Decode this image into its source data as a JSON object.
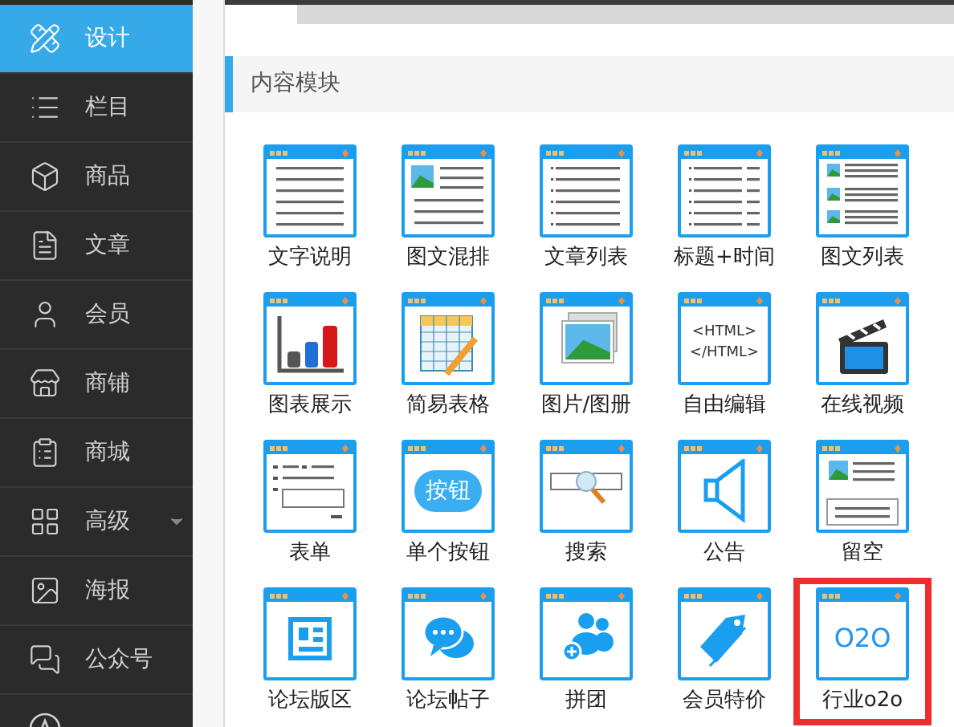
{
  "sidebar": {
    "items": [
      {
        "label": "设计",
        "kind": "design",
        "selected": true,
        "has_dropdown": false
      },
      {
        "label": "栏目",
        "kind": "list",
        "selected": false,
        "has_dropdown": false
      },
      {
        "label": "商品",
        "kind": "box",
        "selected": false,
        "has_dropdown": false
      },
      {
        "label": "文章",
        "kind": "doc",
        "selected": false,
        "has_dropdown": false
      },
      {
        "label": "会员",
        "kind": "user",
        "selected": false,
        "has_dropdown": false
      },
      {
        "label": "商铺",
        "kind": "store",
        "selected": false,
        "has_dropdown": false
      },
      {
        "label": "商城",
        "kind": "clipboard",
        "selected": false,
        "has_dropdown": false
      },
      {
        "label": "高级",
        "kind": "grid",
        "selected": false,
        "has_dropdown": true
      },
      {
        "label": "海报",
        "kind": "poster",
        "selected": false,
        "has_dropdown": false
      },
      {
        "label": "公众号",
        "kind": "chat",
        "selected": false,
        "has_dropdown": false
      },
      {
        "kind": "app",
        "selected": false,
        "has_dropdown": false
      }
    ]
  },
  "section": {
    "title": "内容模块",
    "modules": [
      {
        "label": "文字说明",
        "kind": "text",
        "selected": false
      },
      {
        "label": "图文混排",
        "kind": "mixed",
        "selected": false
      },
      {
        "label": "文章列表",
        "kind": "bullets",
        "selected": false
      },
      {
        "label": "标题+时间",
        "kind": "titletime",
        "selected": false
      },
      {
        "label": "图文列表",
        "kind": "imagelist",
        "selected": false
      },
      {
        "label": "图表展示",
        "kind": "chart",
        "selected": false
      },
      {
        "label": "简易表格",
        "kind": "table",
        "selected": false
      },
      {
        "label": "图片/图册",
        "kind": "photo",
        "selected": false
      },
      {
        "label": "自由编辑",
        "kind": "html",
        "icon_text": [
          "<HTML>",
          "</HTML>"
        ],
        "selected": false
      },
      {
        "label": "在线视频",
        "kind": "video",
        "selected": false
      },
      {
        "label": "表单",
        "kind": "form",
        "selected": false
      },
      {
        "label": "单个按钮",
        "kind": "button",
        "icon_text": [
          "按钮"
        ],
        "selected": false
      },
      {
        "label": "搜索",
        "kind": "search",
        "selected": false
      },
      {
        "label": "公告",
        "kind": "speaker",
        "selected": false
      },
      {
        "label": "留空",
        "kind": "blank",
        "selected": false
      },
      {
        "label": "论坛版区",
        "kind": "board",
        "selected": false
      },
      {
        "label": "论坛帖子",
        "kind": "comments",
        "selected": false
      },
      {
        "label": "拼团",
        "kind": "group",
        "selected": false
      },
      {
        "label": "会员特价",
        "kind": "tag",
        "selected": false
      },
      {
        "label": "行业o2o",
        "kind": "o2o",
        "icon_text": [
          "O2O"
        ],
        "selected": true
      }
    ]
  }
}
